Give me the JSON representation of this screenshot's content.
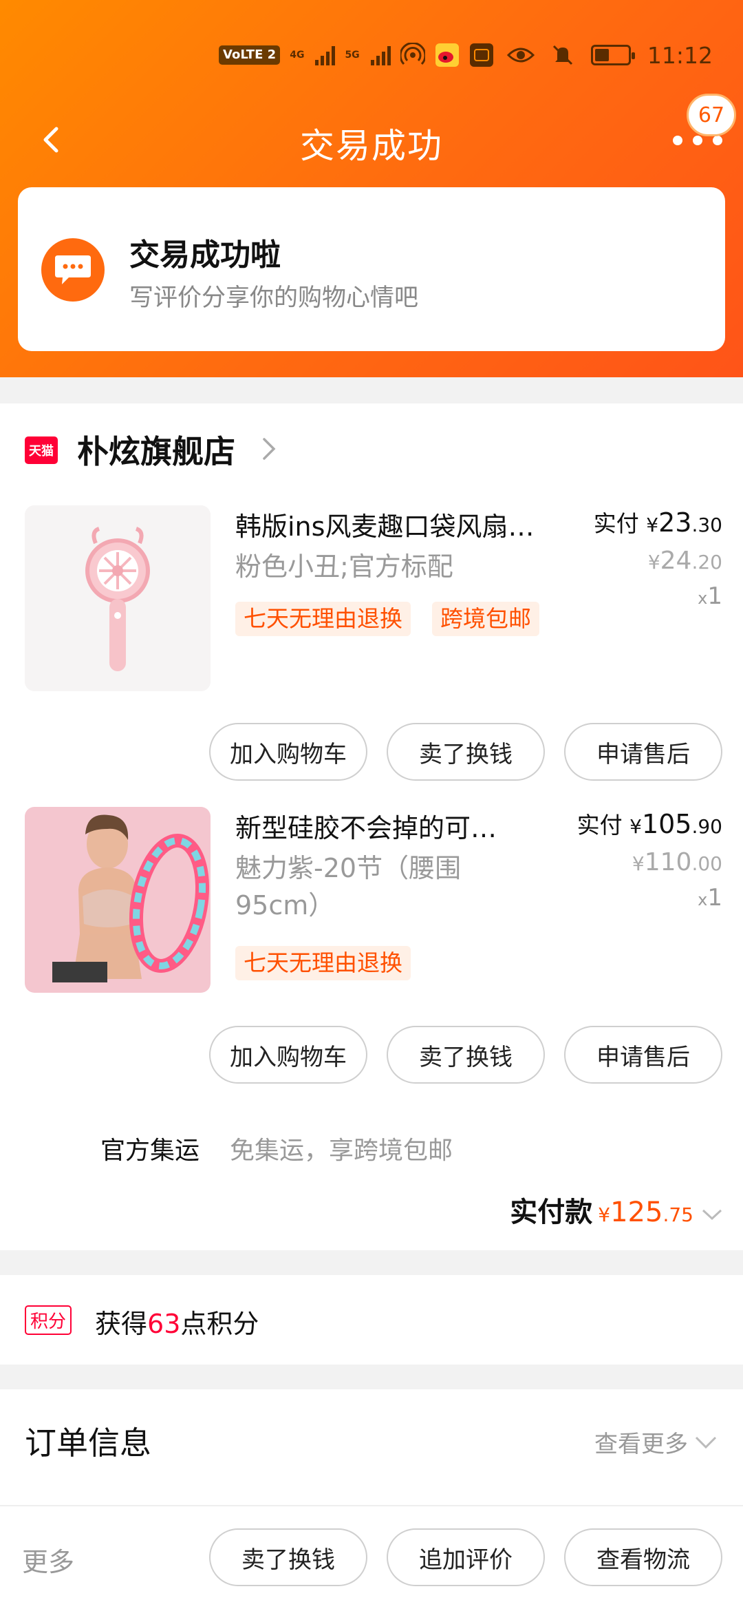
{
  "status_bar": {
    "volte": "VoLTE",
    "sim": "2",
    "net1": "4G",
    "net2": "5G",
    "time": "11:12"
  },
  "nav": {
    "title": "交易成功",
    "badge_count": "67"
  },
  "success": {
    "title": "交易成功啦",
    "subtitle": "写评价分享你的购物心情吧"
  },
  "store": {
    "logo_text": "天猫",
    "name": "朴炫旗舰店"
  },
  "products": [
    {
      "title": "韩版ins风麦趣口袋风扇…",
      "sku": "粉色小丑;官方标配",
      "tags": [
        "七天无理由退换",
        "跨境包邮"
      ],
      "paid_label": "实付",
      "paid_yen": "¥",
      "paid_int": "23",
      "paid_dec": ".30",
      "orig_yen": "¥",
      "orig_int": "24",
      "orig_dec": ".20",
      "qty_x": "x",
      "qty": "1",
      "buttons": [
        "加入购物车",
        "卖了换钱",
        "申请售后"
      ]
    },
    {
      "title": "新型硅胶不会掉的可…",
      "sku": "魅力紫-20节（腰围95cm）",
      "tags": [
        "七天无理由退换"
      ],
      "paid_label": "实付",
      "paid_yen": "¥",
      "paid_int": "105",
      "paid_dec": ".90",
      "orig_yen": "¥",
      "orig_int": "110",
      "orig_dec": ".00",
      "qty_x": "x",
      "qty": "1",
      "buttons": [
        "加入购物车",
        "卖了换钱",
        "申请售后"
      ]
    }
  ],
  "shipping": {
    "label": "官方集运",
    "value": "免集运，享跨境包邮"
  },
  "total": {
    "label": "实付款",
    "yen": "¥",
    "int": "125",
    "dec": ".75"
  },
  "points": {
    "tag": "积分",
    "prefix": "获得",
    "number": "63",
    "suffix": "点积分"
  },
  "order_info": {
    "title": "订单信息",
    "more": "查看更多"
  },
  "bottom": {
    "more": "更多",
    "buttons": [
      "卖了换钱",
      "追加评价",
      "查看物流"
    ]
  },
  "colors": {
    "brand_orange": "#ff6a10",
    "price_orange": "#ff5000",
    "tmall_red": "#ff0036"
  }
}
